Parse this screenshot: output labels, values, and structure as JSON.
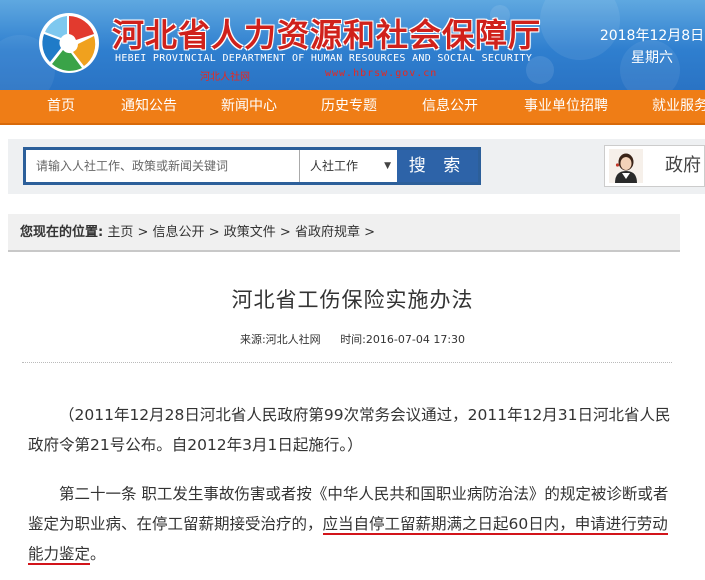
{
  "header": {
    "title": "河北省人力资源和社会保障厅",
    "title_en": "HEBEI PROVINCIAL DEPARTMENT OF HUMAN RESOURCES AND SOCIAL SECURITY",
    "sub_label": "河北人社网",
    "url_text": "www.hbrsw.gov.cn",
    "date": "2018年12月8日",
    "weekday": "星期六"
  },
  "nav": {
    "items": [
      {
        "label": "首页"
      },
      {
        "label": "通知公告"
      },
      {
        "label": "新闻中心"
      },
      {
        "label": "历史专题"
      },
      {
        "label": "信息公开"
      },
      {
        "label": "事业单位招聘"
      },
      {
        "label": "就业服务"
      }
    ]
  },
  "search": {
    "placeholder": "请输入人社工作、政策或新闻关键词",
    "category": "人社工作",
    "button_label": "搜 索"
  },
  "service": {
    "label": "政府"
  },
  "breadcrumb": {
    "label": "您现在的位置:",
    "items": [
      "主页",
      "信息公开",
      "政策文件",
      "省政府规章"
    ],
    "separator": ">"
  },
  "article": {
    "title": "河北省工伤保险实施办法",
    "source": "来源:河北人社网",
    "time": "时间:2016-07-04 17:30",
    "para1": "（2011年12月28日河北省人民政府第99次常务会议通过，2011年12月31日河北省人民政府令第21号公布。自2012年3月1日起施行。）",
    "para2_a": "第二十一条 职工发生事故伤害或者按《中华人民共和国职业病防治法》的规定被诊断或者鉴定为职业病、在停工留薪期接受治疗的，",
    "para2_b": "应当自停工留薪期满之日起60日内，申请进行劳动能力鉴定",
    "para2_c": "。"
  },
  "colors": {
    "header_blue": "#2f7fcf",
    "title_red": "#d0211b",
    "nav_orange": "#ef7d16",
    "search_button": "#2d63a8",
    "underline_red": "#d2141a"
  }
}
